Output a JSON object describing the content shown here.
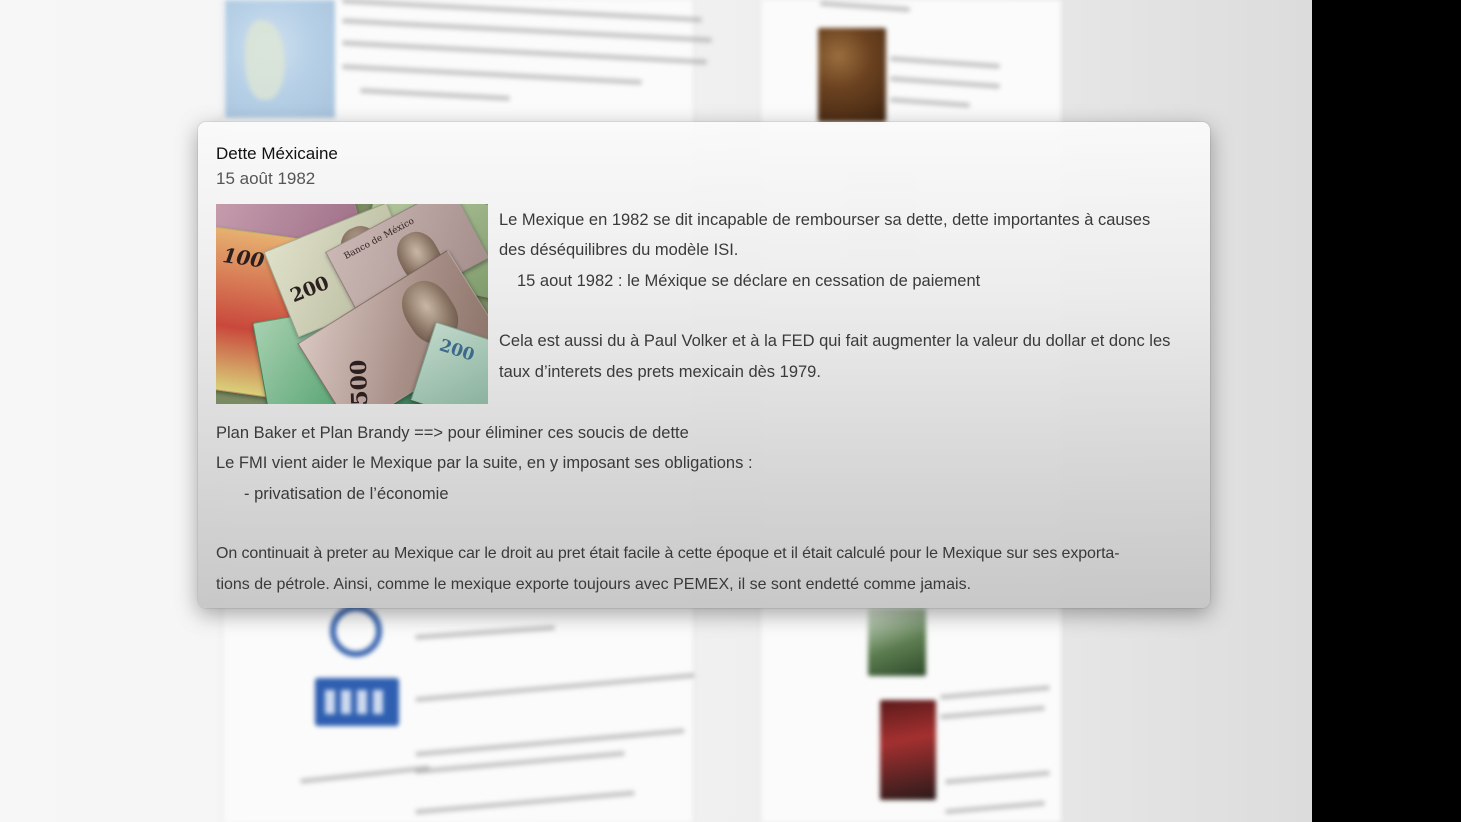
{
  "card": {
    "title": "Dette Méxicaine",
    "date": "15 août 1982",
    "image_alt": "Billets de banque mexicains (Banco de México, 100, 200, 500 pesos)",
    "notes": {
      "n100": "100",
      "n200": "200",
      "n500": "500",
      "n200b": "200",
      "bank": "Banco de México"
    },
    "paragraph1": {
      "line1": "Le Mexique en 1982 se dit incapable de rembourser sa dette, dette importantes à causes",
      "line2": "des déséquilibres du modèle ISI.",
      "line3": "15 aout 1982 : le Méxique se déclare en cessation de paiement"
    },
    "paragraph2": {
      "line1": "Cela est aussi du à Paul Volker et à la FED qui fait augmenter la valeur du dollar et donc les",
      "line2": "taux d’interets des prets mexicain dès 1979."
    },
    "paragraph3": {
      "line1": "Plan Baker et Plan Brandy ==> pour éliminer ces soucis de dette",
      "line2": "Le FMI vient aider le Mexique par la suite, en y imposant ses obligations :",
      "line3": "- privatisation de l’économie"
    },
    "paragraph4": {
      "line1": "On continuait à preter au Mexique car le droit au pret était facile à cette époque et il était calculé pour le Mexique sur ses exporta-",
      "line2": "tions de pétrole. Ainsi, comme le mexique exporte toujours avec PEMEX, il se sont endetté comme jamais."
    }
  }
}
